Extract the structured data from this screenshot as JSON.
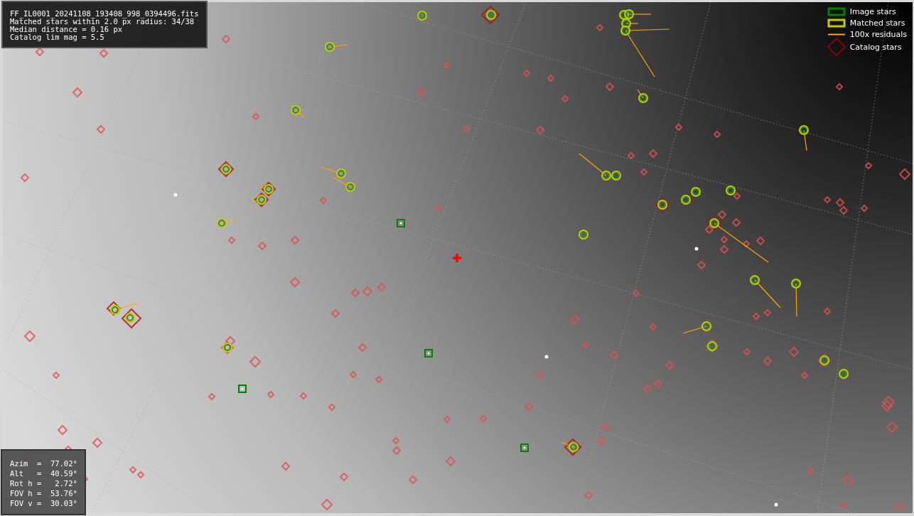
{
  "info_panel": {
    "lines": [
      "FF_IL0001_20241108_193408_998_0394496.fits",
      "Matched stars within 2.0 px radius: 34/38",
      "Median distance = 0.16 px",
      "Catalog lim mag = 5.5"
    ]
  },
  "legend": {
    "items": [
      {
        "kind": "box",
        "color": "#008000",
        "label": "Image stars"
      },
      {
        "kind": "box",
        "color": "#c8c800",
        "label": "Matched stars"
      },
      {
        "kind": "line",
        "color": "#ffa500",
        "label": "100x residuals"
      },
      {
        "kind": "diamond",
        "color": "#8b0000",
        "label": "Catalog stars"
      }
    ]
  },
  "pointing_panel": {
    "lines": [
      "Azim  =  77.02°",
      "Alt   =  40.59°",
      "Rot h =   2.72°",
      "FOV h =  53.76°",
      "FOV v =  30.03°"
    ]
  }
}
